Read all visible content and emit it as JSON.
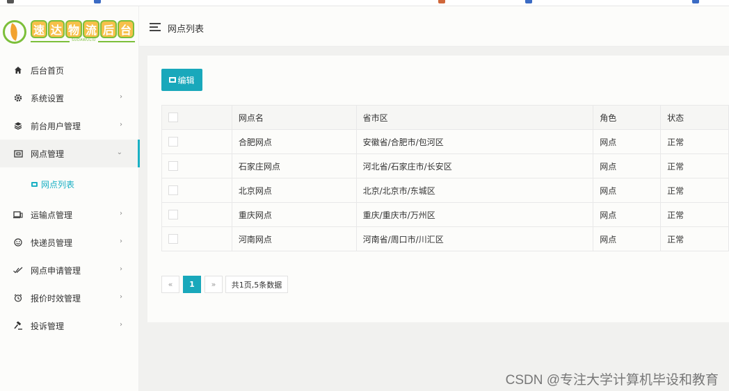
{
  "logo": {
    "chars": [
      "速",
      "达",
      "物",
      "流",
      "后",
      "台"
    ],
    "subtitle": "SUDAWULIU"
  },
  "header": {
    "title": "网点列表"
  },
  "sidebar": {
    "items": [
      {
        "label": "后台首页",
        "icon": "home-icon",
        "arrow": ""
      },
      {
        "label": "系统设置",
        "icon": "gear-icon",
        "arrow": "›"
      },
      {
        "label": "前台用户管理",
        "icon": "layers-icon",
        "arrow": "›"
      },
      {
        "label": "网点管理",
        "icon": "outlet-icon",
        "arrow": "⌄"
      },
      {
        "label": "运输点管理",
        "icon": "devices-icon",
        "arrow": "›"
      },
      {
        "label": "快递员管理",
        "icon": "smile-icon",
        "arrow": "›"
      },
      {
        "label": "网点申请管理",
        "icon": "check-double-icon",
        "arrow": "›"
      },
      {
        "label": "报价时效管理",
        "icon": "clock-icon",
        "arrow": "›"
      },
      {
        "label": "投诉管理",
        "icon": "gavel-icon",
        "arrow": "›"
      }
    ],
    "sub_item": {
      "label": "网点列表",
      "icon": "outlet-list-icon"
    }
  },
  "toolbar": {
    "edit_label": "编辑"
  },
  "table": {
    "columns": [
      "网点名",
      "省市区",
      "角色",
      "状态"
    ],
    "rows": [
      {
        "name": "合肥网点",
        "region": "安徽省/合肥市/包河区",
        "role": "网点",
        "status": "正常"
      },
      {
        "name": "石家庄网点",
        "region": "河北省/石家庄市/长安区",
        "role": "网点",
        "status": "正常"
      },
      {
        "name": "北京网点",
        "region": "北京/北京市/东城区",
        "role": "网点",
        "status": "正常"
      },
      {
        "name": "重庆网点",
        "region": "重庆/重庆市/万州区",
        "role": "网点",
        "status": "正常"
      },
      {
        "name": "河南网点",
        "region": "河南省/周口市/川汇区",
        "role": "网点",
        "status": "正常"
      }
    ]
  },
  "pagination": {
    "prev": "«",
    "current": "1",
    "next": "»",
    "info": "共1页,5条数据"
  },
  "watermark": "CSDN @专注大学计算机毕设和教育",
  "colors": {
    "accent": "#19a8bb",
    "status_ok": "#1aa36e",
    "logo_green": "#7cbf3a",
    "logo_orange": "#f6c04a"
  }
}
